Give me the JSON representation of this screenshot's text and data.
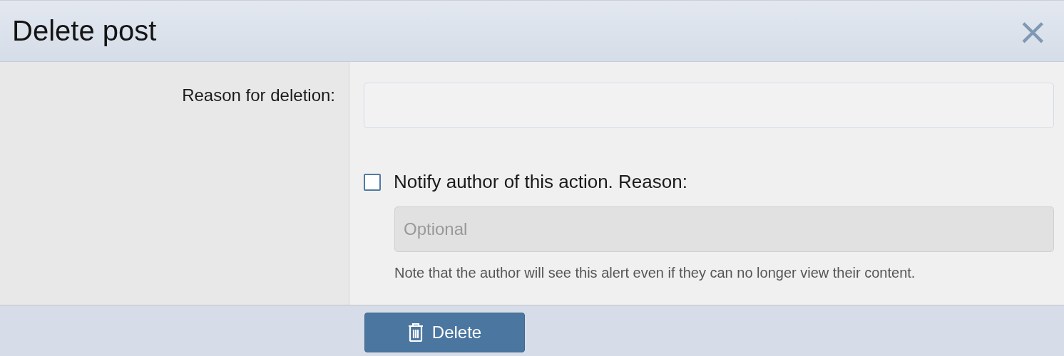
{
  "dialog": {
    "title": "Delete post",
    "close": "×"
  },
  "form": {
    "reason_label": "Reason for deletion:",
    "reason_field": {
      "disabled": false
    },
    "notify": {
      "label": "Notify author of this action. Reason:",
      "checked": false
    },
    "notify_field": {
      "placeholder": "Optional",
      "disabled": true
    },
    "note": "Note that the author will see this alert even if they can no longer view their content."
  },
  "button": {
    "label": "Delete"
  }
}
